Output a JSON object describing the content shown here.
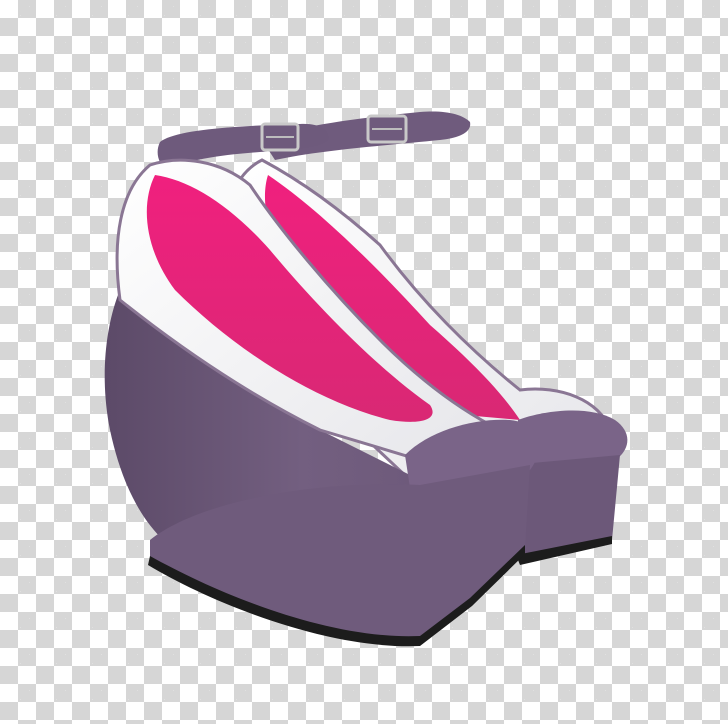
{
  "image": {
    "background": "transparency-checkerboard",
    "subject": "wedge-heel-pumps-pair",
    "colors": {
      "wedge": "#6f5a7a",
      "wedge_shadow": "#5a4866",
      "upper": "#f2f2f4",
      "lining": "#e0287a",
      "toe_cap": "#7a6488",
      "strap": "#6e5a7c",
      "sole_edge": "#1c1c1c"
    }
  }
}
